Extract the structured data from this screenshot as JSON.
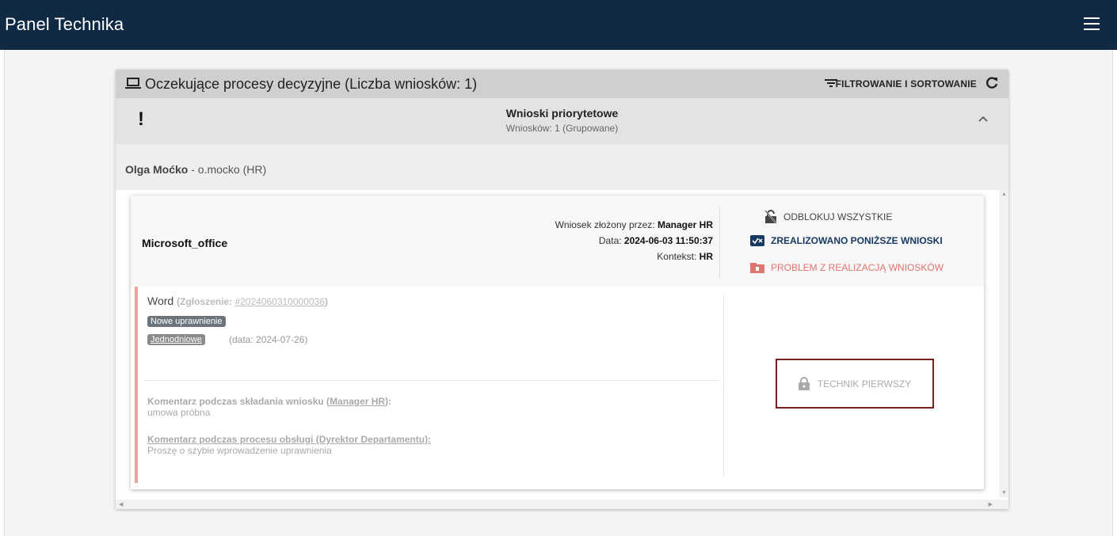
{
  "app": {
    "title": "Panel Technika"
  },
  "colors": {
    "topbar": "#102a43",
    "accent_dark": "#17385f",
    "danger": "#e2736f",
    "highlight_border": "#7a1f1f"
  },
  "panel": {
    "title": "Oczekujące procesy decyzyjne (Liczba wniosków: 1)",
    "filter_label": "FILTROWANIE I SORTOWANIE"
  },
  "group": {
    "title": "Wnioski priorytetowe",
    "subtitle": "Wniosków: 1 (Grupowane)"
  },
  "user": {
    "name": "Olga Moćko",
    "rest": " - o.mocko (HR)"
  },
  "request": {
    "name": "Microsoft_office",
    "submitted_by_label": "Wniosek złożony przez: ",
    "submitted_by": "Manager HR",
    "date_label": "Data: ",
    "date": "2024-06-03 11:50:37",
    "context_label": "Kontekst: ",
    "context": "HR",
    "actions": {
      "unlock": "ODBLOKUJ WSZYSTKIE",
      "done": "ZREALIZOWANO PONIŻSZE WNIOSKI",
      "problem": "PROBLEM Z REALIZACJĄ WNIOSKÓW"
    }
  },
  "item": {
    "name": "Word",
    "ticket_label": "(Zgłoszenie: ",
    "ticket_no": "#2024060310000036",
    "ticket_close": ")",
    "badge_type": "Nowe uprawnienie",
    "badge_duration": "Jednodniowe",
    "duration_date": "(data: 2024-07-26)",
    "comment1_title_pre": "Komentarz podczas składania wniosku (",
    "comment1_author": "Manager HR",
    "comment1_title_post": "):",
    "comment1_text": "umowa próbna",
    "comment2_title": "Komentarz podczas procesu obsługi (Dyrektor Departamentu):",
    "comment2_text": "Proszę o szybie wprowadzenie uprawnienia",
    "tech_button": "TECHNIK PIERWSZY"
  }
}
